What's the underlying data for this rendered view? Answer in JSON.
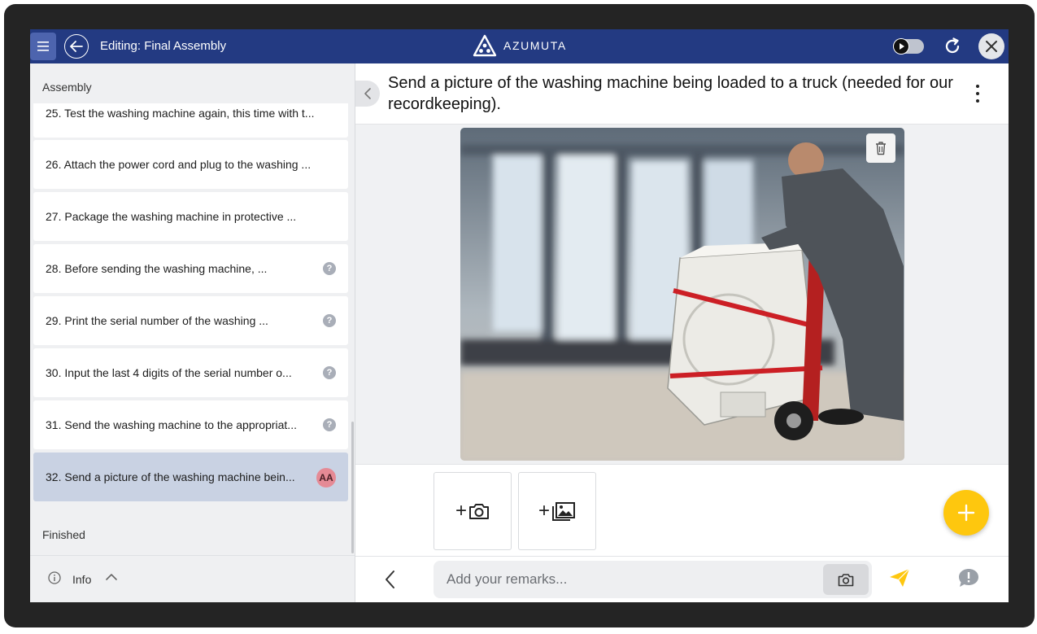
{
  "header": {
    "title": "Editing: Final Assembly",
    "brand": "AZUMUTA",
    "colors": {
      "bar": "#233a82",
      "accent": "#fec70e"
    }
  },
  "sidebar": {
    "section_title": "Assembly",
    "steps": [
      {
        "label": "25. Test the washing machine again, this time with t...",
        "badge": ""
      },
      {
        "label": "26. Attach the power cord and plug to the washing ...",
        "badge": ""
      },
      {
        "label": "27. Package the washing machine in protective ...",
        "badge": ""
      },
      {
        "label": "28. Before sending the washing machine, ...",
        "badge": "?"
      },
      {
        "label": "29. Print the serial number of the washing ...",
        "badge": "?"
      },
      {
        "label": "30. Input the last 4 digits of the serial number o...",
        "badge": "?"
      },
      {
        "label": "31. Send the washing machine to the appropriat...",
        "badge": "?"
      },
      {
        "label": "32. Send a picture of the washing machine bein...",
        "badge": "AA",
        "active": true
      }
    ],
    "finished_title": "Finished",
    "footer": {
      "info_label": "Info"
    }
  },
  "main": {
    "step_title": "Send a picture of the washing machine being loaded to a truck (needed for our recordkeeping).",
    "remarks_placeholder": "Add your remarks...",
    "icons": [
      "menu-icon",
      "back-arrow-icon",
      "toggle-play-icon",
      "refresh-icon",
      "close-icon",
      "trash-icon",
      "add-photo-camera-icon",
      "add-gallery-image-icon",
      "plus-icon",
      "chevron-left-icon",
      "camera-icon",
      "send-icon",
      "feedback-icon",
      "info-icon",
      "chevron-up-icon",
      "more-vertical-icon"
    ]
  }
}
